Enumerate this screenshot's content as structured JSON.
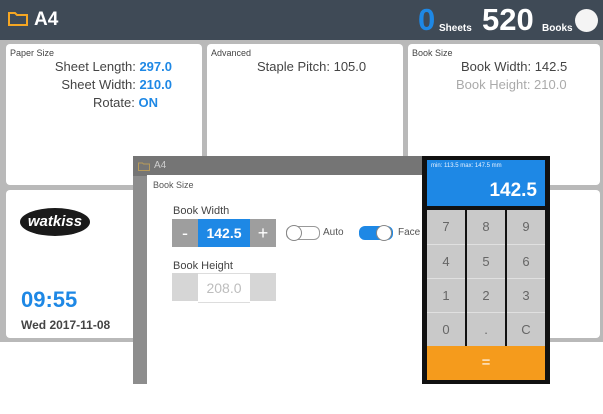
{
  "header": {
    "title": "A4",
    "sheets_count": "0",
    "sheets_label": "Sheets",
    "books_count": "520",
    "books_label": "Books"
  },
  "paper_size": {
    "title": "Paper Size",
    "length_label": "Sheet Length:",
    "length_value": "297.0",
    "width_label": "Sheet Width:",
    "width_value": "210.0",
    "rotate_label": "Rotate:",
    "rotate_value": "ON"
  },
  "advanced": {
    "title": "Advanced",
    "staple_pitch": "Staple Pitch: 105.0"
  },
  "book_size": {
    "title": "Book Size",
    "width": "Book Width: 142.5",
    "height": "Book Height: 210.0"
  },
  "brand": {
    "logo": "watkiss"
  },
  "clock": {
    "time": "09:55",
    "date": "Wed 2017-11-08"
  },
  "dialog": {
    "window_title": "A4",
    "panel_title": "Book Size",
    "width_label": "Book Width",
    "width_value": "142.5",
    "minus": "-",
    "plus": "+",
    "auto_label": "Auto",
    "face_label": "Face Tr",
    "height_label": "Book Height",
    "height_value": "208.0"
  },
  "keypad": {
    "range": "min: 113.5  max: 147.5 mm",
    "value": "142.5",
    "keys": [
      "7",
      "8",
      "9",
      "4",
      "5",
      "6",
      "1",
      "2",
      "3",
      "0",
      ".",
      "C"
    ],
    "equals": "="
  },
  "colors": {
    "accent": "#1e88e5",
    "topbar": "#3f4a56",
    "folder": "#f5a623",
    "enter": "#f59b1c"
  },
  "icons": {
    "folder": "folder-icon",
    "toggle": "toggle-switch",
    "power": "circle-button"
  }
}
